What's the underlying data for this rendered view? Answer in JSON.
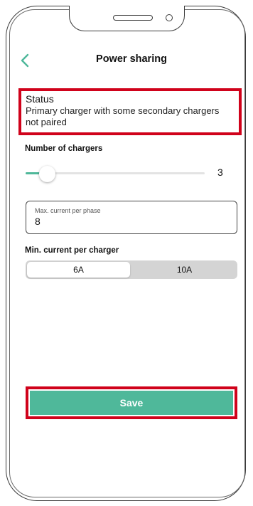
{
  "colors": {
    "accent": "#4fb89a",
    "highlight": "#d0021b",
    "segment_bg": "#d4d4d4"
  },
  "header": {
    "title": "Power sharing",
    "back_icon": "chevron-left-icon"
  },
  "status": {
    "title": "Status",
    "text": "Primary charger with some secondary chargers not paired"
  },
  "chargers": {
    "label": "Number of chargers",
    "value": "3",
    "slider_fraction": 0.12
  },
  "max_current": {
    "label": "Max. current per phase",
    "value": "8"
  },
  "min_current": {
    "label": "Min. current per charger",
    "options": [
      "6A",
      "10A"
    ],
    "selected": "6A"
  },
  "save": {
    "label": "Save"
  }
}
